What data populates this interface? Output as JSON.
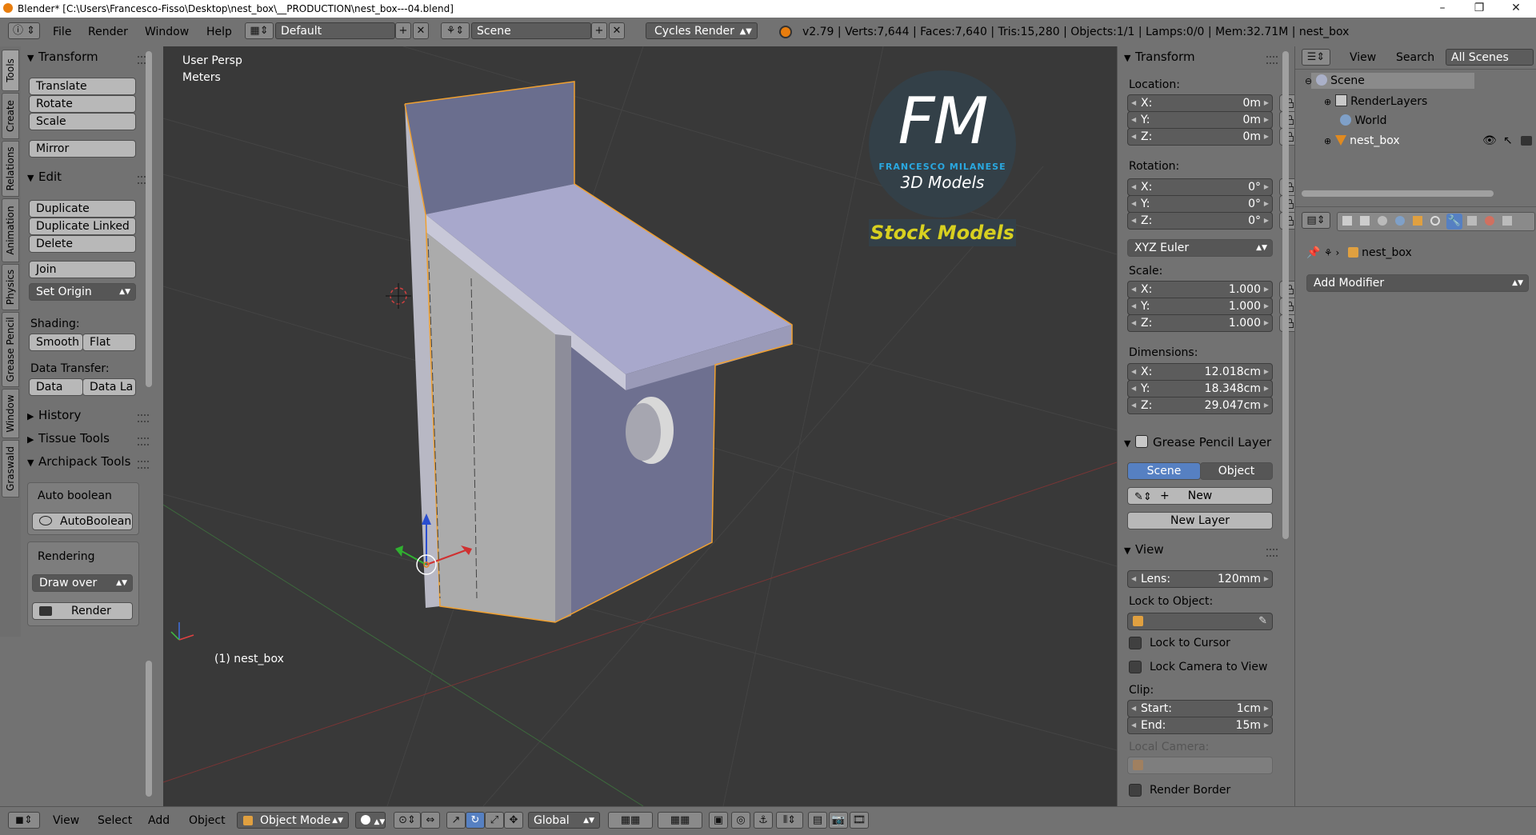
{
  "window": {
    "title": "Blender* [C:\\Users\\Francesco-Fisso\\Desktop\\nest_box\\__PRODUCTION\\nest_box---04.blend]",
    "controls": [
      "minimize",
      "restore",
      "close"
    ]
  },
  "info_header": {
    "menus": [
      "File",
      "Render",
      "Window",
      "Help"
    ],
    "screen_layout": "Default",
    "scene": "Scene",
    "render_engine": "Cycles Render",
    "stats": "v2.79 | Verts:7,644 | Faces:7,640 | Tris:15,280 | Objects:1/1 | Lamps:0/0 | Mem:32.71M | nest_box"
  },
  "tool_tabs": [
    "Tools",
    "Create",
    "Relations",
    "Animation",
    "Physics",
    "Grease Pencil",
    "Window",
    "Graswald"
  ],
  "tool_shelf": {
    "transform": {
      "title": "Transform",
      "buttons": [
        "Translate",
        "Rotate",
        "Scale",
        "Mirror"
      ]
    },
    "edit": {
      "title": "Edit",
      "buttons": [
        "Duplicate",
        "Duplicate Linked",
        "Delete",
        "Join"
      ],
      "set_origin": "Set Origin",
      "shading_label": "Shading:",
      "shading": [
        "Smooth",
        "Flat"
      ],
      "data_transfer_label": "Data Transfer:",
      "data_transfer": [
        "Data",
        "Data La"
      ]
    },
    "history": "History",
    "tissue_tools": "Tissue Tools",
    "archipack": {
      "title": "Archipack Tools",
      "auto_boolean_label": "Auto boolean",
      "auto_boolean_button": "AutoBoolean",
      "rendering_label": "Rendering",
      "draw_mode": "Draw over",
      "render_button": "Render"
    }
  },
  "viewport": {
    "view_name": "User Persp",
    "units": "Meters",
    "active_object": "(1) nest_box",
    "logo": {
      "initials": "FM",
      "name": "FRANCESCO MILANESE",
      "tagline": "3D Models",
      "banner": "Stock Models"
    }
  },
  "properties_panel": {
    "transform_title": "Transform",
    "location_label": "Location:",
    "location": [
      {
        "axis": "X:",
        "value": "0m"
      },
      {
        "axis": "Y:",
        "value": "0m"
      },
      {
        "axis": "Z:",
        "value": "0m"
      }
    ],
    "rotation_label": "Rotation:",
    "rotation": [
      {
        "axis": "X:",
        "value": "0°"
      },
      {
        "axis": "Y:",
        "value": "0°"
      },
      {
        "axis": "Z:",
        "value": "0°"
      }
    ],
    "rotation_mode": "XYZ Euler",
    "scale_label": "Scale:",
    "scale": [
      {
        "axis": "X:",
        "value": "1.000"
      },
      {
        "axis": "Y:",
        "value": "1.000"
      },
      {
        "axis": "Z:",
        "value": "1.000"
      }
    ],
    "dimensions_label": "Dimensions:",
    "dimensions": [
      {
        "axis": "X:",
        "value": "12.018cm"
      },
      {
        "axis": "Y:",
        "value": "18.348cm"
      },
      {
        "axis": "Z:",
        "value": "29.047cm"
      }
    ],
    "grease_pencil": {
      "title": "Grease Pencil Layer",
      "scene": "Scene",
      "object": "Object",
      "new": "New",
      "new_layer": "New Layer"
    },
    "view": {
      "title": "View",
      "lens_label": "Lens:",
      "lens": "120mm",
      "lock_to_object_label": "Lock to Object:",
      "lock_to_cursor": "Lock to Cursor",
      "lock_camera": "Lock Camera to View",
      "clip_label": "Clip:",
      "clip_start_label": "Start:",
      "clip_start": "1cm",
      "clip_end_label": "End:",
      "clip_end": "15m",
      "local_camera_label": "Local Camera:",
      "render_border": "Render Border"
    }
  },
  "outliner": {
    "menus": [
      "View",
      "Search"
    ],
    "filter": "All Scenes",
    "items": [
      "Scene",
      "RenderLayers",
      "World",
      "nest_box"
    ]
  },
  "properties_editor": {
    "object_name": "nest_box",
    "add_modifier": "Add Modifier"
  },
  "bottom_header": {
    "menus": [
      "View",
      "Select",
      "Add",
      "Object"
    ],
    "mode": "Object Mode",
    "orientation": "Global"
  },
  "colors": {
    "selection_outline": "#f0a030",
    "panel_bg": "#727272",
    "viewport_bg": "#393939",
    "active_tab": "#5680c2",
    "logo_blue": "#2aa8e0",
    "banner_yellow": "#d8d020"
  }
}
